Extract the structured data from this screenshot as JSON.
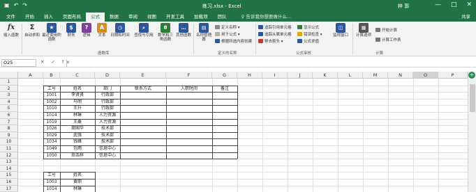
{
  "titlebar": {
    "title": "练习.xlsx  -  Excel",
    "user": "梓 郭",
    "undo": "↶",
    "redo": "↷",
    "save": "▣",
    "min": "—",
    "max": "□",
    "close": "✕"
  },
  "tabs": [
    "文件",
    "开始",
    "插入",
    "页面布局",
    "公式",
    "数据",
    "审阅",
    "视图",
    "开发工具",
    "加载项",
    "团队"
  ],
  "active_tab": "公式",
  "search": "♀ 告诉我你想要做什么...",
  "share": "共享",
  "ribbon": {
    "insert_fn": "插入函数",
    "autosum": "自动求和",
    "recent": "最近使用的函数",
    "financial": "财务",
    "logical": "逻辑",
    "text": "文本",
    "datetime": "日期和时间",
    "lookup": "查找与引用",
    "math": "数学和三角函数",
    "more": "其他函数",
    "library_group": "函数库",
    "name_mgr": "名称管理器",
    "define_name": "定义名称 ▾",
    "use_in_formula": "用于公式 ▾",
    "create_from_sel": "根据所选内容创建",
    "names_group": "定义的名称",
    "trace_prec": "追踪引用单元格",
    "trace_dep": "追踪从属单元格",
    "remove_arrows": "移去箭头 ▾",
    "show_formulas": "显示公式",
    "error_check": "错误检查 ▾",
    "eval_formula": "公式求值",
    "audit_group": "公式审核",
    "watch": "监视窗口",
    "calc_options": "计算选项",
    "calc_now": "开始计算",
    "calc_sheet": "计算工作表",
    "calc_group": "计算"
  },
  "namebox": "O25",
  "fx": "✕ ✓ fx",
  "columns": [
    "A",
    "B",
    "C",
    "D",
    "E",
    "F",
    "G",
    "H",
    "I",
    "J",
    "K",
    "L",
    "M",
    "N",
    "O",
    "P"
  ],
  "rows": [
    "1",
    "2",
    "3",
    "4",
    "5",
    "6",
    "7",
    "8",
    "9",
    "10",
    "11",
    "12",
    "13",
    "14",
    "15",
    "16",
    "17"
  ],
  "table1": {
    "headers": [
      "工号",
      "姓名",
      "部门",
      "联系方式",
      "入职时间",
      "备注"
    ],
    "rows": [
      [
        "1001",
        "李贤贤",
        "行政部"
      ],
      [
        "1002",
        "马明",
        "行政部"
      ],
      [
        "1010",
        "王升",
        "行政部"
      ],
      [
        "1014",
        "林琳",
        "人力资源"
      ],
      [
        "1019",
        "王桑",
        "人力资源"
      ],
      [
        "1026",
        "周国华",
        "技术部"
      ],
      [
        "1029",
        "武强",
        "技术部"
      ],
      [
        "1034",
        "钱峰",
        "技术部"
      ],
      [
        "1049",
        "包雨",
        "信息中心"
      ],
      [
        "1050",
        "郑浩梓",
        "信息中心"
      ]
    ]
  },
  "table2": {
    "headers": [
      "工号",
      "姓名"
    ],
    "rows": [
      [
        "1003",
        "黄职"
      ],
      [
        "1014",
        "林琳"
      ]
    ]
  }
}
